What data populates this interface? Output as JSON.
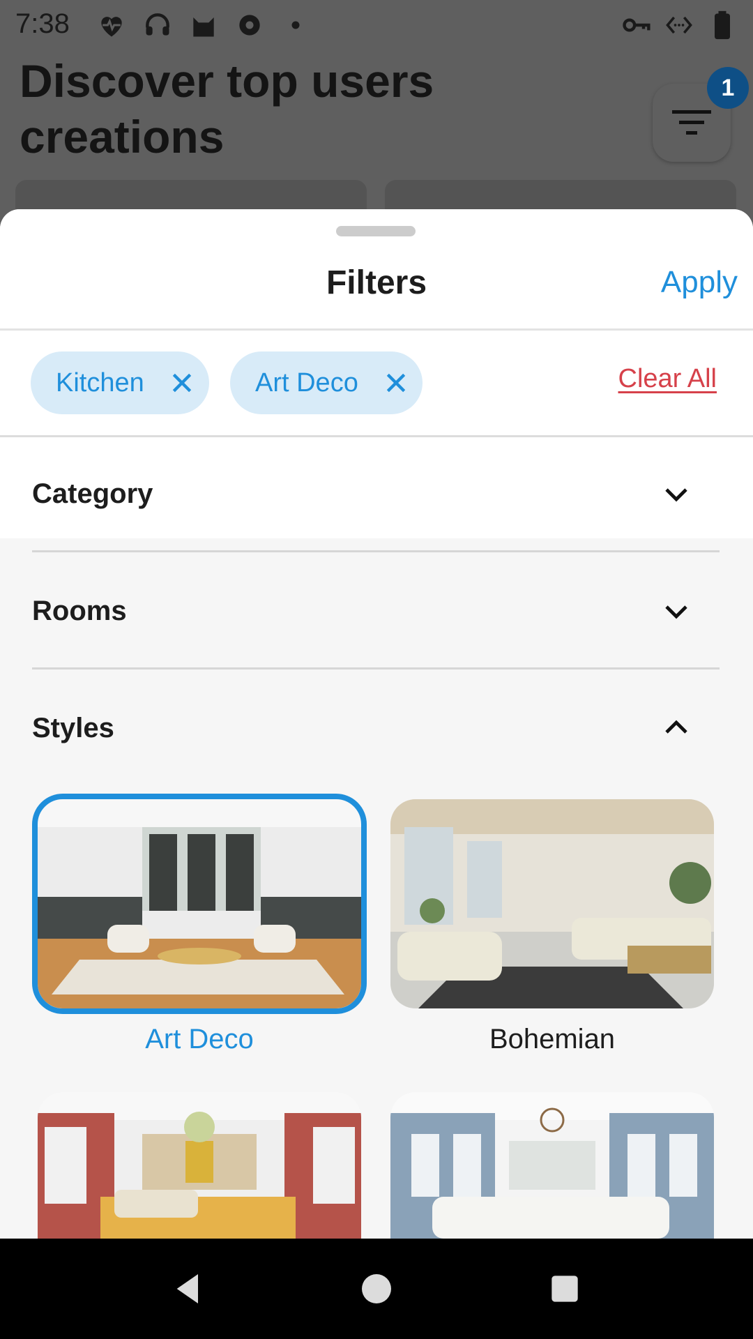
{
  "status_bar": {
    "time": "7:38",
    "icons_left": [
      "heart-monitor-icon",
      "headphones-icon",
      "cat-icon",
      "settings-gear-icon",
      "dot-icon"
    ],
    "icons_right": [
      "vpn-key-icon",
      "data-arrows-icon",
      "battery-icon"
    ]
  },
  "background": {
    "title": "Discover top users creations",
    "filter_badge_count": "1"
  },
  "sheet": {
    "title": "Filters",
    "apply_label": "Apply",
    "chips": [
      {
        "label": "Kitchen"
      },
      {
        "label": "Art Deco"
      }
    ],
    "clear_all_label": "Clear All",
    "sections": [
      {
        "label": "Category",
        "expanded": false
      },
      {
        "label": "Rooms",
        "expanded": false
      },
      {
        "label": "Styles",
        "expanded": true
      }
    ],
    "styles": [
      {
        "label": "Art Deco",
        "selected": true
      },
      {
        "label": "Bohemian",
        "selected": false
      },
      {
        "label": "",
        "selected": false
      },
      {
        "label": "",
        "selected": false
      }
    ]
  },
  "colors": {
    "accent": "#1f8fdb",
    "chip_bg": "#d8ebf8",
    "clear_all": "#d6414a",
    "badge": "#0e4f86"
  }
}
